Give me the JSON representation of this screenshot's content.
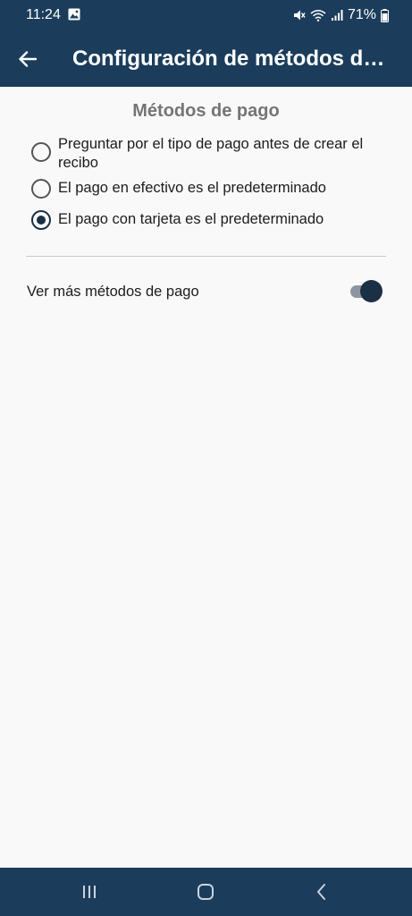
{
  "status_bar": {
    "time": "11:24",
    "battery": "71%",
    "icons": [
      "gallery-icon",
      "mute-icon",
      "wifi-icon",
      "signal-icon",
      "battery-icon"
    ]
  },
  "app_bar": {
    "title": "Configuración de métodos de pago",
    "back_icon": "back-arrow-icon"
  },
  "payment_methods": {
    "section_title": "Métodos de pago",
    "options": [
      {
        "label": "Preguntar por el tipo de pago antes de crear el recibo",
        "selected": false
      },
      {
        "label": "El pago en efectivo es el predeterminado",
        "selected": false
      },
      {
        "label": "El pago con tarjeta es el predeterminado",
        "selected": true
      }
    ]
  },
  "more_methods": {
    "label": "Ver más métodos de pago",
    "enabled": true
  },
  "nav_bar": {
    "icons": [
      "recent-apps-icon",
      "home-icon",
      "back-icon"
    ]
  },
  "colors": {
    "primary": "#1b3d5b",
    "accent": "#1b2f45",
    "background": "#f9f9f9",
    "section_title": "#757575"
  }
}
